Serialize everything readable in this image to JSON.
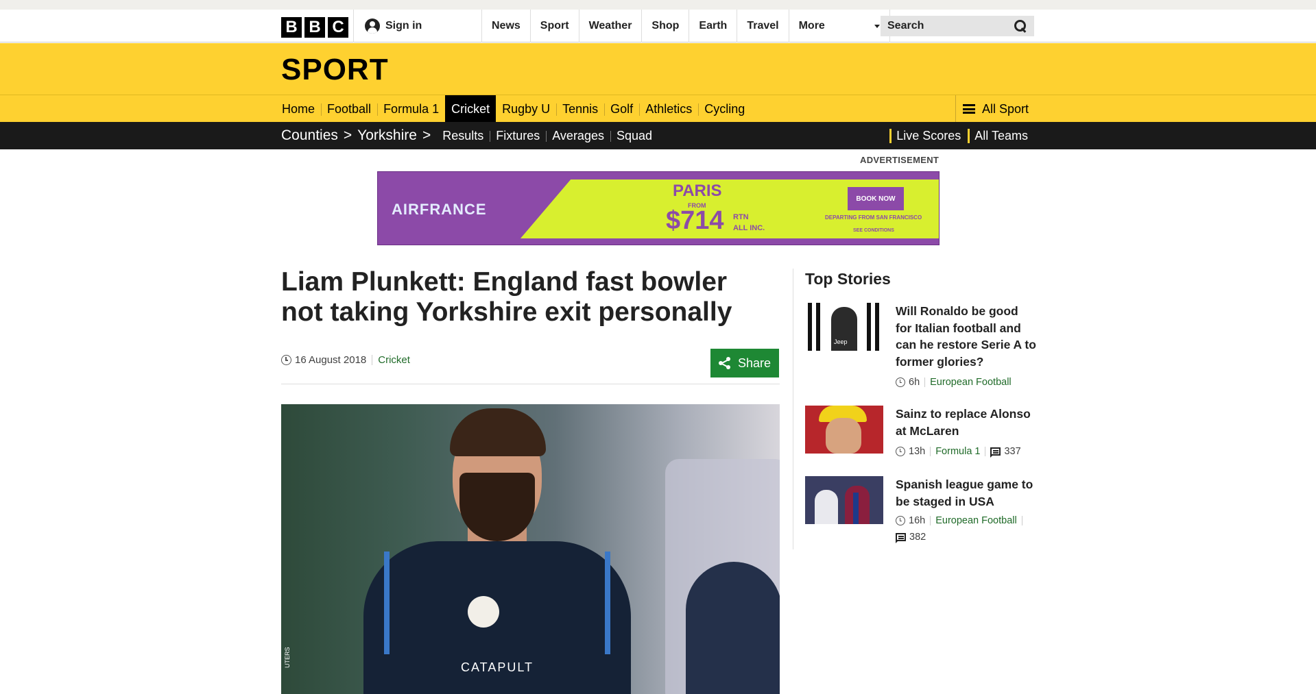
{
  "global_nav": {
    "logo_letters": [
      "B",
      "B",
      "C"
    ],
    "sign_in": "Sign in",
    "items": [
      "News",
      "Sport",
      "Weather",
      "Shop",
      "Earth",
      "Travel"
    ],
    "more": "More",
    "search_placeholder": "Search"
  },
  "masthead": {
    "title": "SPORT"
  },
  "sport_nav": {
    "items": [
      {
        "label": "Home",
        "active": false
      },
      {
        "label": "Football",
        "active": false
      },
      {
        "label": "Formula 1",
        "active": false
      },
      {
        "label": "Cricket",
        "active": true
      },
      {
        "label": "Rugby U",
        "active": false
      },
      {
        "label": "Tennis",
        "active": false
      },
      {
        "label": "Golf",
        "active": false
      },
      {
        "label": "Athletics",
        "active": false
      },
      {
        "label": "Cycling",
        "active": false
      }
    ],
    "all_sport": "All Sport"
  },
  "secondary_nav": {
    "crumbs": [
      "Counties",
      "Yorkshire"
    ],
    "links": [
      "Results",
      "Fixtures",
      "Averages",
      "Squad"
    ],
    "right_links": [
      "Live Scores",
      "All Teams"
    ]
  },
  "advertisement": {
    "label": "ADVERTISEMENT",
    "brand": "AIRFRANCE",
    "city": "PARIS",
    "from": "FROM",
    "price": "$714",
    "rtn_line1": "RTN",
    "rtn_line2": "ALL INC.",
    "book": "BOOK NOW",
    "departing": "DEPARTING FROM SAN FRANCISCO",
    "conditions": "SEE CONDITIONS",
    "colors": {
      "purple": "#8c4aa8",
      "lime": "#d8ef2f"
    }
  },
  "article": {
    "headline": "Liam Plunkett: England fast bowler not taking Yorkshire exit personally",
    "date": "16 August 2018",
    "section": "Cricket",
    "share": "Share",
    "image_text": "CATAPULT",
    "image_credit": "UTERS"
  },
  "sidebar": {
    "title": "Top Stories",
    "stories": [
      {
        "title": "Will Ronaldo be good for Italian football and can he restore Serie A to former glories?",
        "time": "6h",
        "section": "European Football",
        "comments": null,
        "thumb_text": "Jeep"
      },
      {
        "title": "Sainz to replace Alonso at McLaren",
        "time": "13h",
        "section": "Formula 1",
        "comments": "337"
      },
      {
        "title": "Spanish league game to be staged in USA",
        "time": "16h",
        "section": "European Football",
        "comments": "382"
      }
    ]
  },
  "colors": {
    "sport_yellow": "#fed130",
    "nav_black": "#1a1a1a",
    "link_green": "#1f6a28",
    "share_green": "#1e8834"
  },
  "icons": [
    "user-icon",
    "chevron-down-icon",
    "search-icon",
    "hamburger-icon",
    "clock-icon",
    "share-icon",
    "comment-icon"
  ]
}
